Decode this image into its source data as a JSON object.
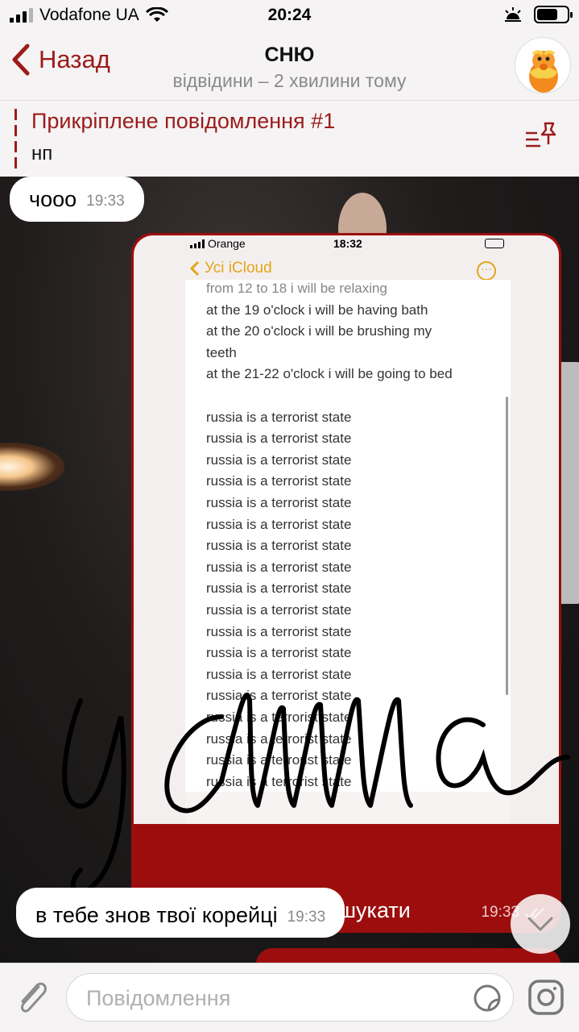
{
  "status_bar": {
    "carrier": "Vodafone UA",
    "time": "20:24",
    "icons": [
      "signal-icon",
      "wifi-icon",
      "alarm-icon",
      "battery-icon"
    ]
  },
  "header": {
    "back_label": "Назад",
    "title": "СНЮ",
    "subtitle": "відвідини – 2 хвилини тому"
  },
  "pinned": {
    "title": "Прикріплене повідомлення #1",
    "text": "нп"
  },
  "messages": [
    {
      "direction": "in",
      "text": "чооо",
      "time": "19:33"
    },
    {
      "direction": "out",
      "type": "image",
      "caption": "я прокладку стала шукати",
      "time": "19:33",
      "read": true
    },
    {
      "direction": "in",
      "text": "в тебе знов твої корейці",
      "time": "19:33"
    }
  ],
  "image_content": {
    "status_carrier": "Orange",
    "status_time": "18:32",
    "nav_back": "Усі iCloud",
    "lines": [
      "from 12 to 18 i will be relaxing",
      "at the 19 o'clock i will be having bath",
      "at the 20 o'clock i will be brushing my",
      "teeth",
      "at the 21-22 o'clock i will be going to bed",
      "",
      "russia is a terrorist state",
      "russia is a terrorist state",
      "russia is a terrorist state",
      "russia is a terrorist state",
      "russia is a terrorist state",
      "russia is a terrorist state",
      "russia is a terrorist state",
      "russia is a terrorist state",
      "russia is a terrorist state",
      "russia is a terrorist state",
      "russia is a terrorist state",
      "russia is a terrorist state",
      "russia is a terrorist state",
      "russia is a terrorist state",
      "russia is a terrorist state",
      "russia is a terrorist state",
      "russia is a terrorist state",
      "russia is a terrorist state"
    ],
    "handwriting": "усllllа"
  },
  "input": {
    "placeholder": "Повідомлення"
  },
  "colors": {
    "accent": "#9c1b1b",
    "outgoing_bubble": "#9c0e0e",
    "notes_accent": "#e3a516"
  }
}
